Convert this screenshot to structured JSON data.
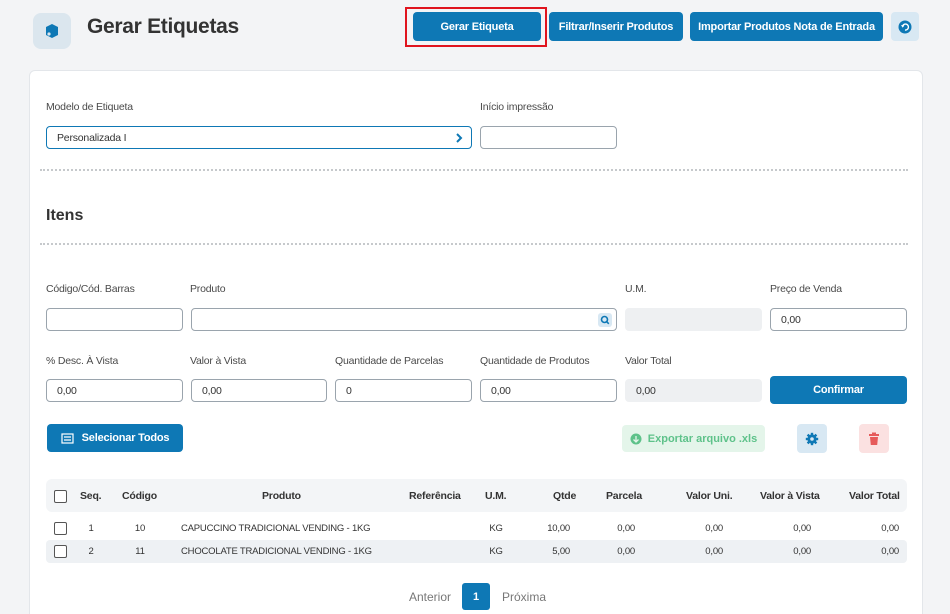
{
  "header": {
    "title": "Gerar Etiquetas",
    "buttons": {
      "gerar": "Gerar Etiqueta",
      "filtrar": "Filtrar/Inserir Produtos",
      "importar": "Importar Produtos Nota de Entrada"
    }
  },
  "config": {
    "modelo_label": "Modelo de Etiqueta",
    "modelo_value": "Personalizada I",
    "inicio_label": "Início impressão",
    "inicio_value": ""
  },
  "itens": {
    "title": "Itens",
    "codigo_label": "Código/Cód. Barras",
    "codigo_value": "",
    "produto_label": "Produto",
    "produto_value": "",
    "um_label": "U.M.",
    "um_value": "",
    "preco_label": "Preço de Venda",
    "preco_value": "0,00",
    "desc_label": "% Desc. À Vista",
    "desc_value": "0,00",
    "valor_vista_label": "Valor à Vista",
    "valor_vista_value": "0,00",
    "qtd_parcelas_label": "Quantidade de Parcelas",
    "qtd_parcelas_value": "0",
    "qtd_produtos_label": "Quantidade de Produtos",
    "qtd_produtos_value": "0,00",
    "valor_total_label": "Valor Total",
    "valor_total_value": "0,00",
    "confirmar": "Confirmar"
  },
  "actions": {
    "selecionar_todos": "Selecionar Todos",
    "exportar": "Exportar arquivo .xls"
  },
  "table": {
    "headers": {
      "seq": "Seq.",
      "codigo": "Código",
      "produto": "Produto",
      "referencia": "Referência",
      "um": "U.M.",
      "qtde": "Qtde",
      "parcela": "Parcela",
      "valor_uni": "Valor Uni.",
      "valor_vista": "Valor à Vista",
      "valor_total": "Valor Total"
    },
    "rows": [
      {
        "seq": "1",
        "codigo": "10",
        "produto": "CAPUCCINO TRADICIONAL VENDING - 1KG",
        "referencia": "",
        "um": "KG",
        "qtde": "10,00",
        "parcela": "0,00",
        "valor_uni": "0,00",
        "valor_vista": "0,00",
        "valor_total": "0,00"
      },
      {
        "seq": "2",
        "codigo": "11",
        "produto": "CHOCOLATE TRADICIONAL VENDING - 1KG",
        "referencia": "",
        "um": "KG",
        "qtde": "5,00",
        "parcela": "0,00",
        "valor_uni": "0,00",
        "valor_vista": "0,00",
        "valor_total": "0,00"
      }
    ]
  },
  "pagination": {
    "prev": "Anterior",
    "current": "1",
    "next": "Próxima"
  },
  "colors": {
    "primary": "#0e78b5",
    "highlight": "#e0141e",
    "export_text": "#5ec28a",
    "trash": "#e65a5a"
  }
}
